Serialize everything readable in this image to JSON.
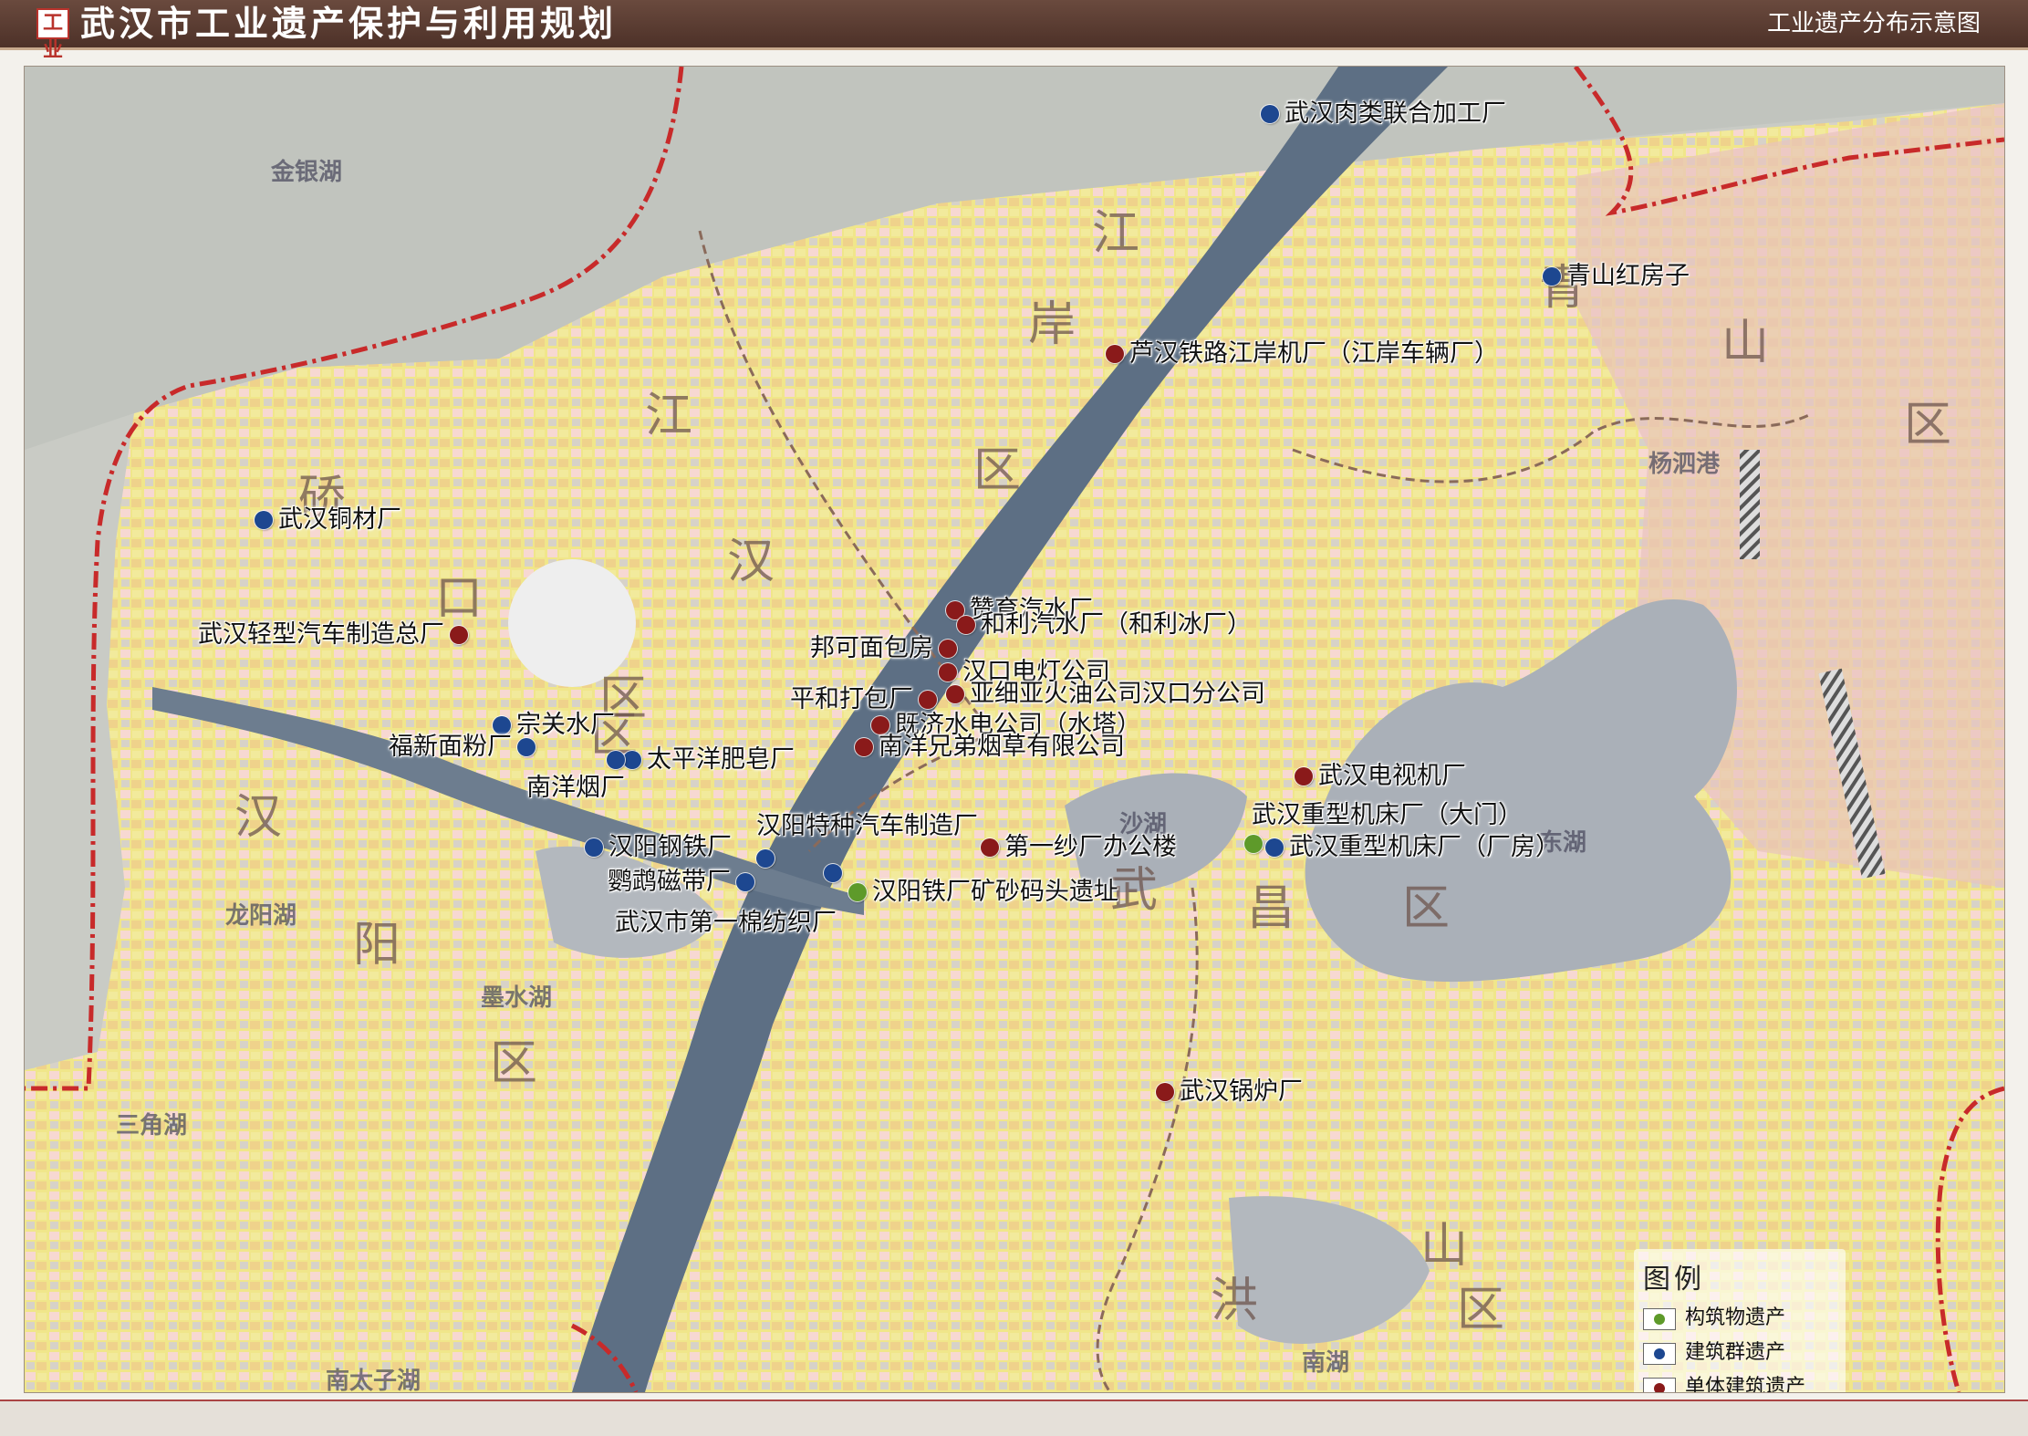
{
  "header": {
    "logo_text": "工业",
    "title": "武汉市工业遗产保护与利用规划",
    "subtitle": "工业遗产分布示意图"
  },
  "colors": {
    "structure_heritage": "#5e9a2a",
    "building_group_heritage": "#1d4790",
    "single_building_heritage": "#8a1a1a",
    "boundary_line": "#c82a2a",
    "river": "#5d6f84"
  },
  "map": {
    "districts": [
      "江",
      "岸",
      "区",
      "江",
      "汉",
      "区",
      "硚",
      "口",
      "区",
      "汉",
      "阳",
      "区",
      "青",
      "山",
      "区",
      "武",
      "昌",
      "区",
      "洪",
      "山",
      "区"
    ],
    "water_labels": [
      "金银湖",
      "沙湖",
      "东湖",
      "墨水湖",
      "龙阳湖",
      "三角湖",
      "南湖",
      "南太子湖",
      "杨泗港"
    ],
    "sites": [
      {
        "name": "武汉肉类联合加工厂",
        "type": "building_group_heritage"
      },
      {
        "name": "青山红房子",
        "type": "building_group_heritage"
      },
      {
        "name": "芦汉铁路江岸机厂（江岸车辆厂）",
        "type": "single_building_heritage"
      },
      {
        "name": "武汉铜材厂",
        "type": "building_group_heritage"
      },
      {
        "name": "赞育汽水厂",
        "type": "single_building_heritage"
      },
      {
        "name": "和利汽水厂（和利冰厂）",
        "type": "single_building_heritage"
      },
      {
        "name": "武汉轻型汽车制造总厂",
        "type": "single_building_heritage"
      },
      {
        "name": "邦可面包房",
        "type": "single_building_heritage"
      },
      {
        "name": "汉口电灯公司",
        "type": "single_building_heritage"
      },
      {
        "name": "亚细亚火油公司汉口分公司",
        "type": "single_building_heritage"
      },
      {
        "name": "平和打包厂",
        "type": "single_building_heritage"
      },
      {
        "name": "既济水电公司（水塔）",
        "type": "single_building_heritage"
      },
      {
        "name": "南洋兄弟烟草有限公司",
        "type": "single_building_heritage"
      },
      {
        "name": "宗关水厂",
        "type": "building_group_heritage"
      },
      {
        "name": "福新面粉厂",
        "type": "building_group_heritage"
      },
      {
        "name": "太平洋肥皂厂",
        "type": "building_group_heritage"
      },
      {
        "name": "南洋烟厂",
        "type": "building_group_heritage"
      },
      {
        "name": "武汉电视机厂",
        "type": "single_building_heritage"
      },
      {
        "name": "汉阳特种汽车制造厂",
        "type": "building_group_heritage"
      },
      {
        "name": "汉阳钢铁厂",
        "type": "building_group_heritage"
      },
      {
        "name": "第一纱厂办公楼",
        "type": "single_building_heritage"
      },
      {
        "name": "武汉重型机床厂（大门）",
        "type": "structure_heritage"
      },
      {
        "name": "武汉重型机床厂（厂房）",
        "type": "building_group_heritage"
      },
      {
        "name": "鹦鹉磁带厂",
        "type": "building_group_heritage"
      },
      {
        "name": "汉阳铁厂矿砂码头遗址",
        "type": "structure_heritage"
      },
      {
        "name": "武汉市第一棉纺织厂",
        "type": "building_group_heritage"
      },
      {
        "name": "武汉锅炉厂",
        "type": "single_building_heritage"
      }
    ]
  },
  "legend": {
    "title": "图例",
    "items": [
      {
        "label": "构筑物遗产",
        "type": "structure_heritage"
      },
      {
        "label": "建筑群遗产",
        "type": "building_group_heritage"
      },
      {
        "label": "单体建筑遗产",
        "type": "single_building_heritage"
      }
    ]
  }
}
